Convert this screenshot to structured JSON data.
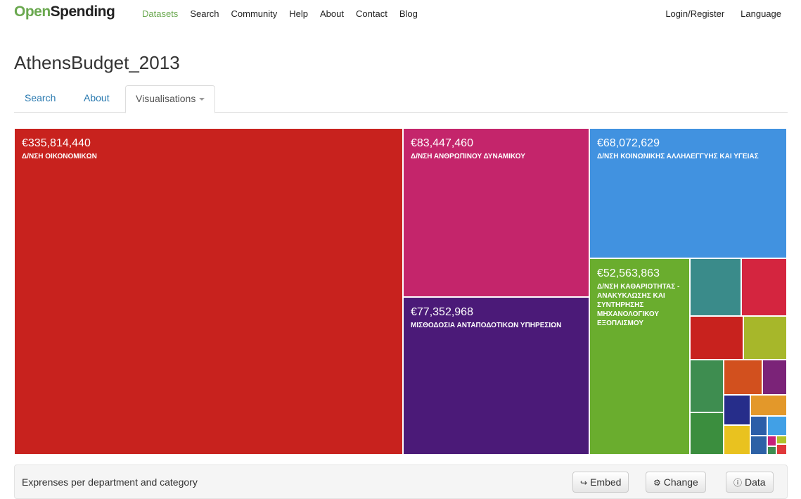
{
  "nav": {
    "brand_open": "Open",
    "brand_spending": "Spending",
    "links": [
      "Datasets",
      "Search",
      "Community",
      "Help",
      "About",
      "Contact",
      "Blog"
    ],
    "login": "Login/Register",
    "language": "Language"
  },
  "page": {
    "title": "AthensBudget_2013"
  },
  "tabs": {
    "search": "Search",
    "about": "About",
    "visualisations": "Visualisations"
  },
  "treemap": {
    "cells": [
      {
        "amount": "€335,814,440",
        "label": "Δ/ΝΣΗ ΟΙΚΟΝΟΜΙΚΩΝ",
        "color": "#c8221e"
      },
      {
        "amount": "€83,447,460",
        "label": "Δ/ΝΣΗ ΑΝΘΡΩΠΙΝΟΥ ΔΥΝΑΜΙΚΟΥ",
        "color": "#c4256b"
      },
      {
        "amount": "€77,352,968",
        "label": "ΜΙΣΘΟΔΟΣΙΑ ΑΝΤΑΠΟΔΟΤΙΚΩΝ ΥΠΗΡΕΣΙΩΝ",
        "color": "#4b1a78"
      },
      {
        "amount": "€68,072,629",
        "label": "Δ/ΝΣΗ ΚΟΙΝΩΝΙΚΗΣ ΑΛΛΗΛΕΓΓΥΗΣ ΚΑΙ ΥΓΕΙΑΣ",
        "color": "#4192e0"
      },
      {
        "amount": "€52,563,863",
        "label": "Δ/ΝΣΗ ΚΑΘΑΡΙΟΤΗΤΑΣ - ΑΝΑΚΥΚΛΩΣΗΣ ΚΑΙ ΣΥΝΤΗΡΗΣΗΣ ΜΗΧΑΝΟΛΟΓΙΚΟΥ ΕΞΟΠΛΙΣΜΟΥ",
        "color": "#6aad2e"
      }
    ],
    "small_colors": [
      "#3a8b8a",
      "#d4253f",
      "#c8221e",
      "#a7b72a",
      "#3e8d50",
      "#d2501e",
      "#7b2378",
      "#262d8a",
      "#e3982a",
      "#3b8e3e",
      "#e9c21f",
      "#2c5ea8",
      "#41a0e6",
      "#2d61a6",
      "#c7217a",
      "#b0c22a",
      "#e0383a",
      "#3e8d50"
    ]
  },
  "footer": {
    "description": "Exprenses per department and category",
    "embed": "Embed",
    "change": "Change",
    "data": "Data"
  }
}
